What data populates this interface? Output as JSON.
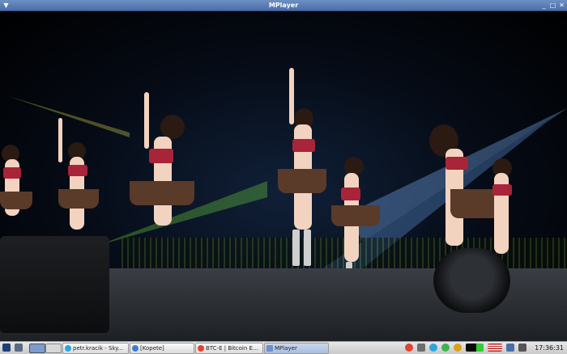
{
  "window": {
    "title": "MPlayer"
  },
  "taskbar": {
    "items": [
      {
        "label": "petr.kracik - Sky...",
        "icon": "skype-icon",
        "color": "#2ba6e0"
      },
      {
        "label": "[Kopete]",
        "icon": "kopete-icon",
        "color": "#3b7fd1"
      },
      {
        "label": "BTC-E | Bitcoin E...",
        "icon": "chrome-icon",
        "color": "#e0432f"
      },
      {
        "label": "MPlayer",
        "icon": "mplayer-icon",
        "color": "#6f8fc8"
      }
    ],
    "clock": "17:36:31"
  },
  "colors": {
    "title_bar": "#5a7fb8",
    "stage": "#2a2d32"
  }
}
